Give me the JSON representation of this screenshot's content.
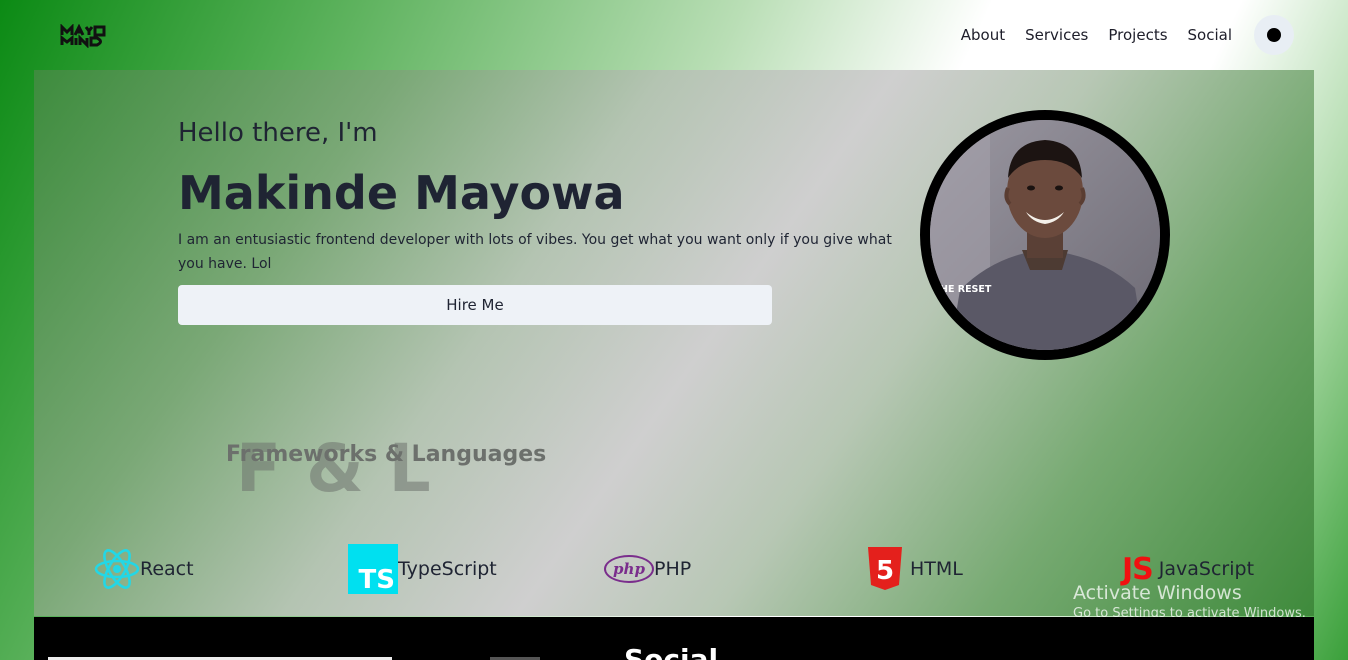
{
  "header": {
    "logo_text": "MAYO MIND",
    "nav": [
      "About",
      "Services",
      "Projects",
      "Social"
    ]
  },
  "hero": {
    "greeting": "Hello there, I'm",
    "name": "Makinde Mayowa",
    "bio": "I am an entusiastic frontend developer with lots of vibes. You get what you want only if you give what you have. Lol",
    "hire_label": "Hire Me",
    "photo_shirt_text": "HE RESET"
  },
  "skills": {
    "watermark": "F & L",
    "title": "Frameworks & Languages",
    "items": [
      {
        "label": "React",
        "icon": "react-icon"
      },
      {
        "label": "TypeScript",
        "icon": "typescript-icon",
        "badge": "TS"
      },
      {
        "label": "PHP",
        "icon": "php-icon",
        "badge": "php"
      },
      {
        "label": "HTML",
        "icon": "html5-icon",
        "badge": "5"
      },
      {
        "label": "JavaScript",
        "icon": "javascript-icon",
        "badge": "JS"
      }
    ]
  },
  "windows_notice": {
    "title": "Activate Windows",
    "subtitle": "Go to Settings to activate Windows."
  },
  "footer": {
    "title_partial": "Social"
  },
  "colors": {
    "react": "#23d7e6",
    "typescript_bg": "#00e0f0",
    "php": "#7a2d8c",
    "html": "#e4201c",
    "javascript": "#f01010"
  }
}
